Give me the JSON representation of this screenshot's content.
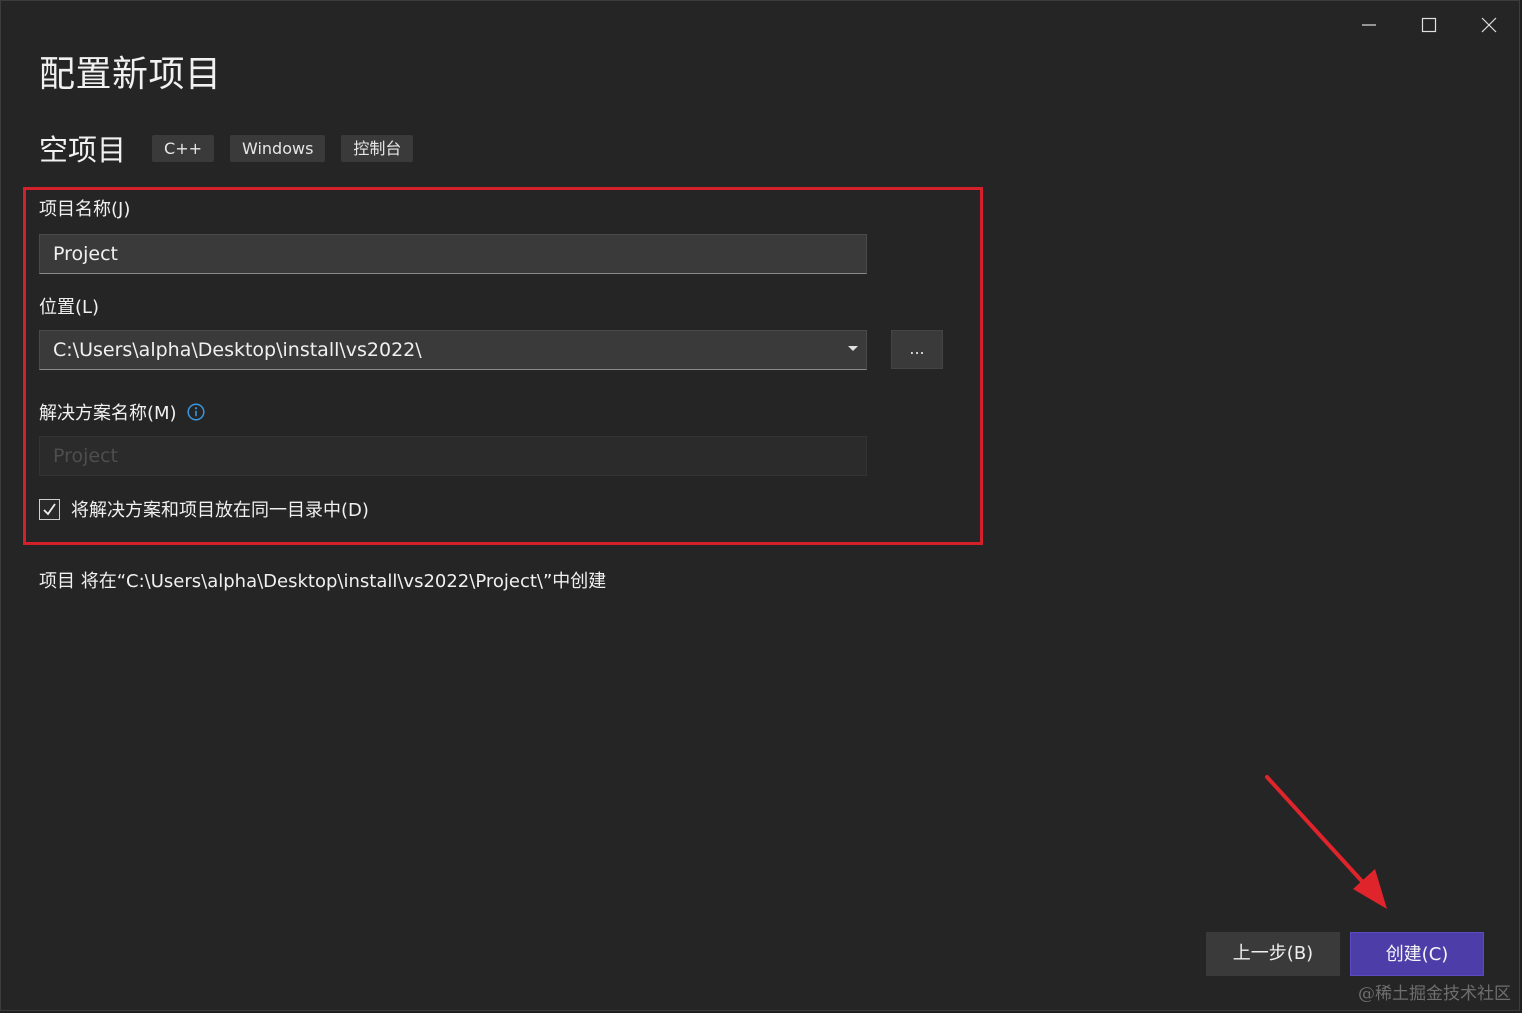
{
  "page_title": "配置新项目",
  "template": {
    "name": "空项目",
    "tags": [
      "C++",
      "Windows",
      "控制台"
    ]
  },
  "project_name": {
    "label": "项目名称(J)",
    "value": "Project"
  },
  "location": {
    "label": "位置(L)",
    "value": "C:\\Users\\alpha\\Desktop\\install\\vs2022\\",
    "browse_label": "..."
  },
  "solution_name": {
    "label": "解决方案名称(M)",
    "placeholder": "Project"
  },
  "same_directory": {
    "label": "将解决方案和项目放在同一目录中(D)",
    "checked": true
  },
  "creation_info": "项目 将在“C:\\Users\\alpha\\Desktop\\install\\vs2022\\Project\\”中创建",
  "buttons": {
    "back": "上一步(B)",
    "create": "创建(C)"
  },
  "watermark": "@稀土掘金技术社区",
  "colors": {
    "accent": "#4c3da8",
    "highlight": "#d4202a",
    "info_icon": "#3a96dd"
  }
}
